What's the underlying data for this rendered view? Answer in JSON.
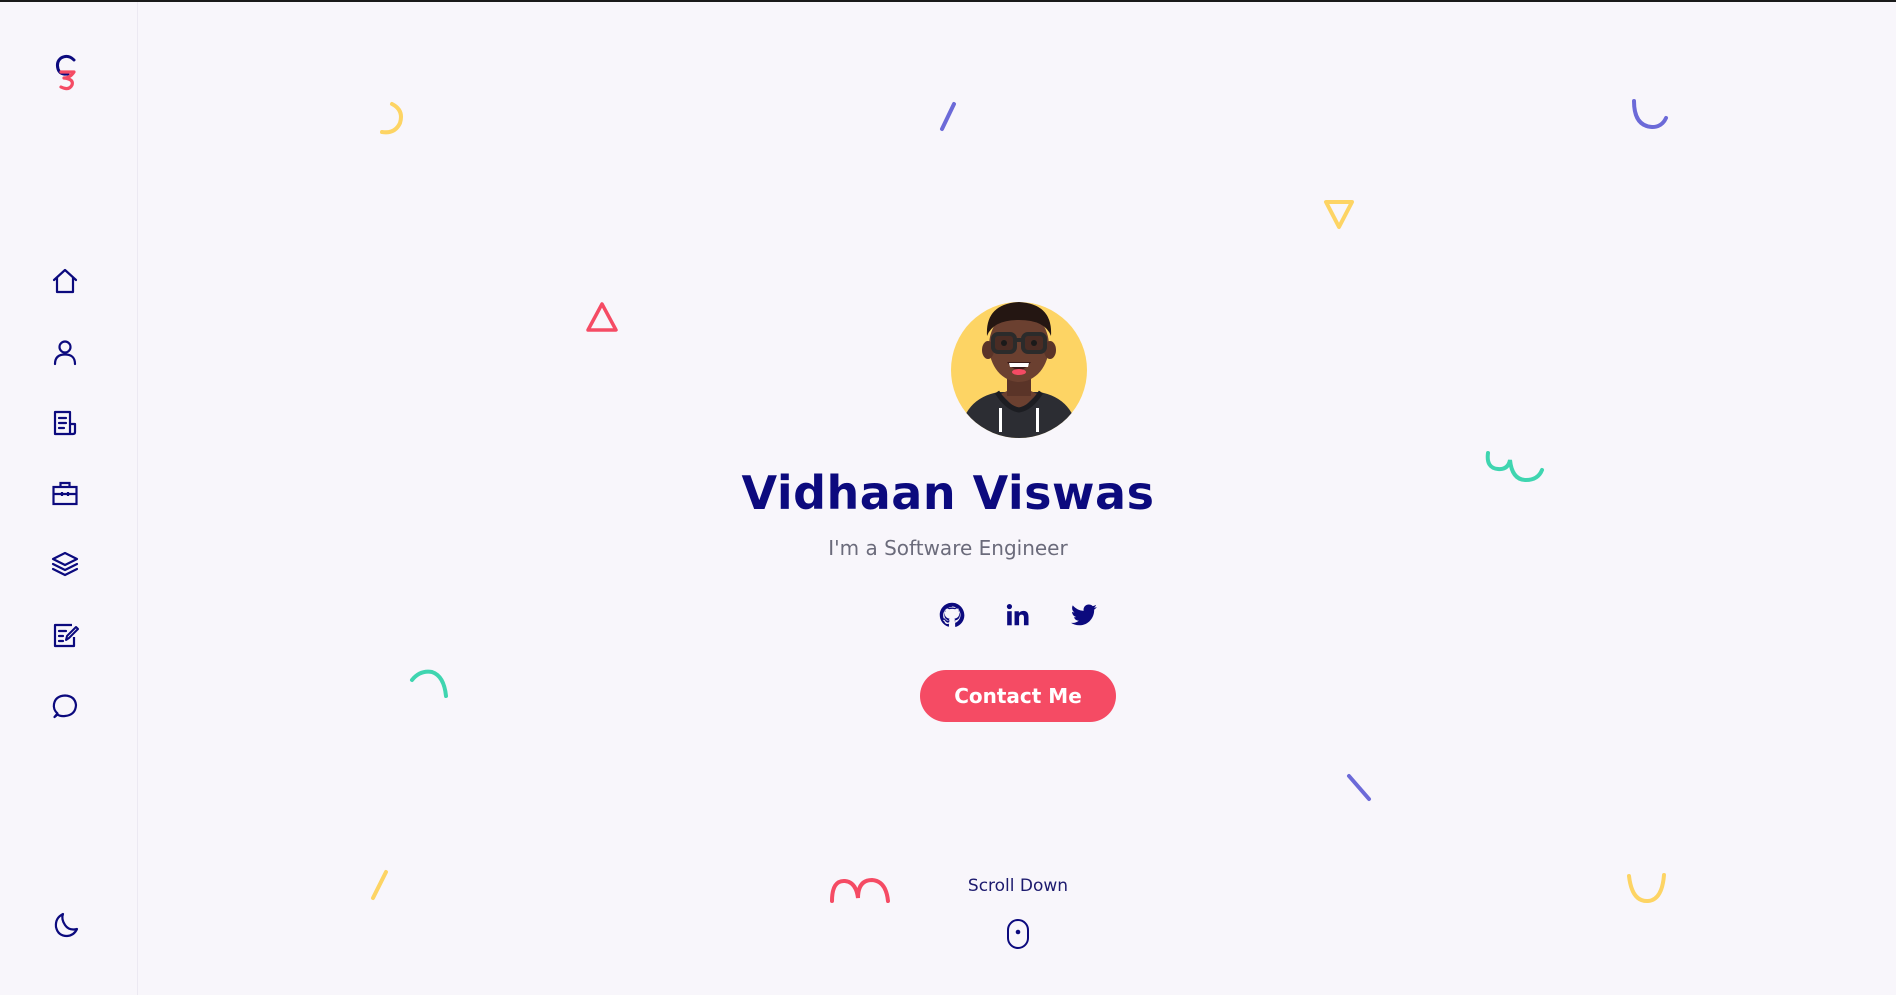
{
  "logo": {
    "letters": "GS",
    "icon": "gs-logo-icon"
  },
  "sidebar": {
    "items": [
      {
        "icon": "home-icon",
        "label": "Home"
      },
      {
        "icon": "user-icon",
        "label": "About"
      },
      {
        "icon": "document-icon",
        "label": "Resume"
      },
      {
        "icon": "briefcase-icon",
        "label": "Portfolio"
      },
      {
        "icon": "layers-icon",
        "label": "Services"
      },
      {
        "icon": "edit-icon",
        "label": "Blog"
      },
      {
        "icon": "chat-icon",
        "label": "Contact"
      }
    ],
    "theme_icon": "moon-icon"
  },
  "hero": {
    "name": "Vidhaan Viswas",
    "subtitle": "I'm a Software Engineer",
    "socials": [
      {
        "icon": "github-icon"
      },
      {
        "icon": "linkedin-icon"
      },
      {
        "icon": "twitter-icon"
      }
    ],
    "contact_label": "Contact Me",
    "scroll_label": "Scroll Down"
  },
  "colors": {
    "primary": "#0c0a7e",
    "accent": "#f54b64",
    "yellow": "#fdd464",
    "purple": "#6c6ad8",
    "teal": "#3fd5b0",
    "background": "#f8f6fb"
  }
}
